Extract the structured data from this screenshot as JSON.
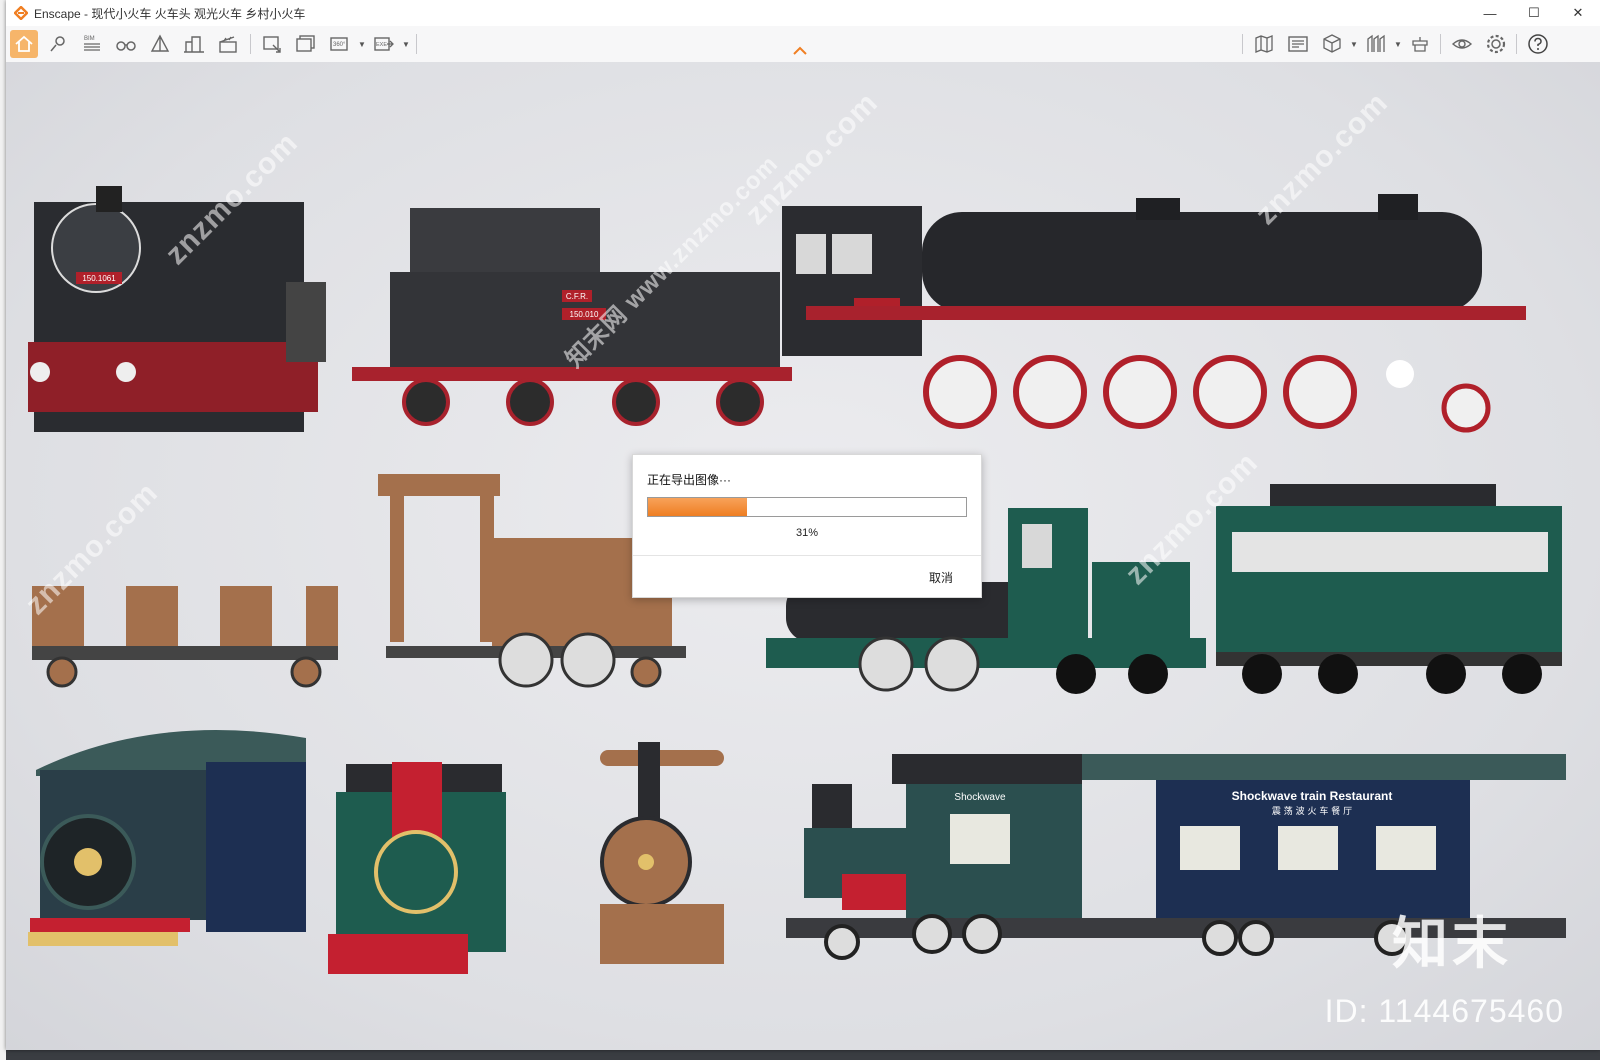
{
  "app": {
    "title": "Enscape - 现代小火车 火车头 观光火车 乡村小火车",
    "accent": "#f07f23"
  },
  "window_buttons": {
    "minimize": "—",
    "maximize": "☐",
    "close": "✕"
  },
  "toolbar": {
    "left_icons": [
      "home-icon",
      "map-pin-icon",
      "bim-icon",
      "binoculars-icon",
      "perspective-icon",
      "buildings-icon",
      "clapperboard-icon",
      "screenshot-icon",
      "batch-render-icon",
      "panorama-360-icon",
      "export-exe-icon"
    ],
    "right_icons": [
      "map-icon",
      "views-icon",
      "cube-icon",
      "asset-library-icon",
      "material-icon",
      "visibility-icon",
      "settings-icon",
      "help-icon"
    ],
    "bim_label": "BIM",
    "pano_label": "360°",
    "exe_label": "EXE"
  },
  "dialog": {
    "message": "正在导出图像···",
    "progress": 0.31,
    "percent_text": "31%",
    "cancel_label": "取消"
  },
  "scene_text": {
    "plate_1": "150.1061",
    "plate_2": "C.F.R.",
    "plate_3": "150.010",
    "restaurant_sign": "Shockwave train Restaurant",
    "restaurant_sign_cn": "震 荡 波 火 车 餐 厅",
    "shockwave_small": "Shockwave",
    "watermark": "znzmo.com",
    "watermark_cn": "知末网 www.znzmo.com",
    "brand_cn": "知末",
    "brand_id": "ID: 1144675460"
  }
}
